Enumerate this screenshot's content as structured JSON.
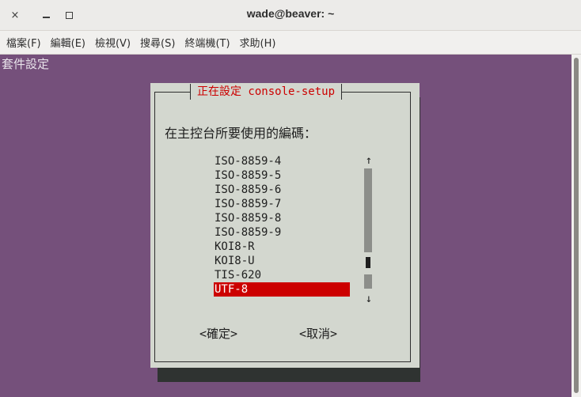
{
  "window": {
    "title": "wade@beaver: ~",
    "close_glyph": "×"
  },
  "menubar": {
    "items": [
      {
        "label": "檔案(F)"
      },
      {
        "label": "編輯(E)"
      },
      {
        "label": "檢視(V)"
      },
      {
        "label": "搜尋(S)"
      },
      {
        "label": "終端機(T)"
      },
      {
        "label": "求助(H)"
      }
    ]
  },
  "terminal": {
    "backtitle": "套件設定",
    "dialog": {
      "title": "正在設定 console-setup",
      "prompt": "在主控台所要使用的編碼：",
      "options": [
        "ISO-8859-4",
        "ISO-8859-5",
        "ISO-8859-6",
        "ISO-8859-7",
        "ISO-8859-8",
        "ISO-8859-9",
        "KOI8-R",
        "KOI8-U",
        "TIS-620",
        "UTF-8"
      ],
      "selected": "UTF-8",
      "scroll_up_glyph": "↑",
      "scroll_down_glyph": "↓",
      "ok_label": "<確定>",
      "cancel_label": "<取消>"
    }
  },
  "colors": {
    "terminal_bg": "#75507b",
    "dialog_bg": "#d3d7cf",
    "dialog_shadow": "#2f3331",
    "accent_red": "#cc0000"
  }
}
